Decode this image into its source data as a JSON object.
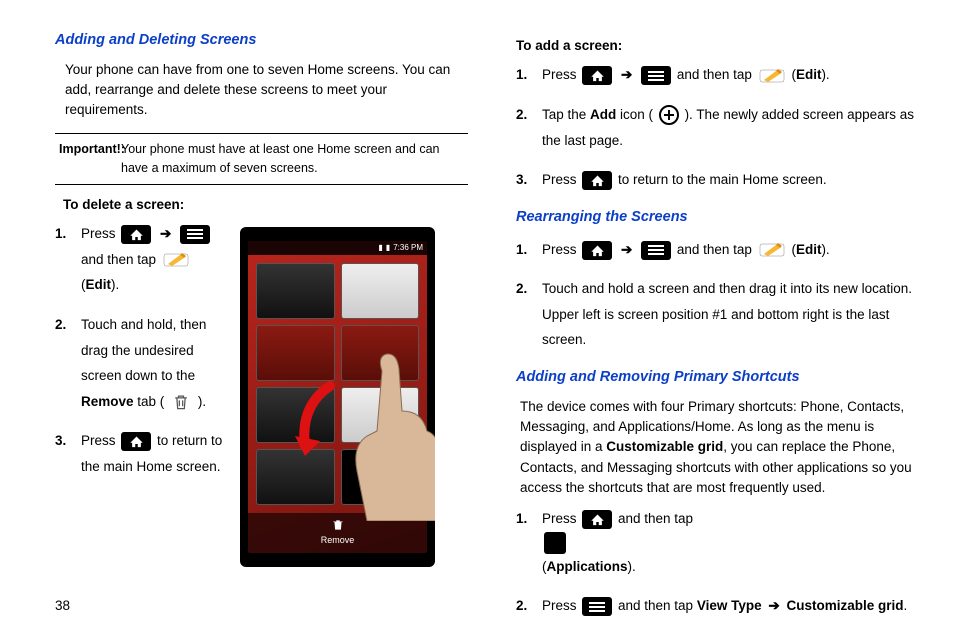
{
  "pageNumber": "38",
  "left": {
    "heading1": "Adding and Deleting Screens",
    "intro": "Your phone can have from one to seven Home screens. You can add, rearrange and delete these screens to meet your requirements.",
    "importantLabel": "Important!:",
    "importantText": "Your phone must have at least one Home screen and can have a maximum of seven screens.",
    "toDelete": "To delete a screen:",
    "deleteSteps": {
      "s1a": "Press ",
      "s1b": " and then tap ",
      "s1c": " (",
      "s1d": "Edit",
      "s1e": ").",
      "s2a": "Touch and hold, then drag the undesired screen down to the ",
      "s2b": "Remove",
      "s2c": " tab (",
      "s2d": ").",
      "s3a": "Press ",
      "s3b": " to return to the main Home screen."
    },
    "phone": {
      "time": "7:36 PM",
      "removeLabel": "Remove"
    }
  },
  "right": {
    "toAdd": "To add a screen:",
    "addSteps": {
      "s1a": "Press ",
      "s1b": " and then tap ",
      "s1c": " (",
      "s1d": "Edit",
      "s1e": ").",
      "s2a": "Tap the ",
      "s2b": "Add",
      "s2c": " icon (",
      "s2d": "). The newly added screen appears as the last page.",
      "s3a": "Press ",
      "s3b": " to return to the main Home screen."
    },
    "heading2": "Rearranging the Screens",
    "rearrangeSteps": {
      "s1a": "Press ",
      "s1b": " and then tap ",
      "s1c": " (",
      "s1d": "Edit",
      "s1e": ").",
      "s2": "Touch and hold a screen and then drag it into its new location. Upper left is screen position #1 and bottom right is the last screen."
    },
    "heading3": "Adding and Removing Primary Shortcuts",
    "shortcutsIntroA": "The device comes with four Primary shortcuts: Phone, Contacts, Messaging, and Applications/Home. As long as the menu is displayed in a ",
    "shortcutsIntroB": "Customizable grid",
    "shortcutsIntroC": ", you can replace the Phone, Contacts, and Messaging shortcuts with other applications so you access the shortcuts that are most frequently used.",
    "shortcutSteps": {
      "s1a": "Press ",
      "s1b": " and then tap ",
      "s1c": " (",
      "s1d": "Applications",
      "s1e": ").",
      "s2a": "Press ",
      "s2b": " and then tap ",
      "s2c": "View Type",
      "s2d": "Customizable grid",
      "s2e": "."
    }
  }
}
